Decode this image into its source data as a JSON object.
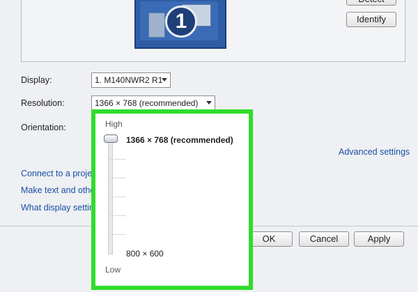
{
  "top_buttons": {
    "detect": "Detect",
    "identify": "Identify"
  },
  "monitor": {
    "number": "1"
  },
  "fields": {
    "display_label": "Display:",
    "display_value": "1. M140NWR2 R1",
    "resolution_label": "Resolution:",
    "resolution_value": "1366 × 768 (recommended)",
    "orientation_label": "Orientation:"
  },
  "links": {
    "advanced": "Advanced settings",
    "projector": "Connect to a projec",
    "text_size": "Make text and other",
    "display_settings": "What display setting"
  },
  "popup": {
    "high": "High",
    "low": "Low",
    "top_option": "1366 × 768 (recommended)",
    "bottom_option": "800 × 600"
  },
  "buttons": {
    "ok": "OK",
    "cancel": "Cancel",
    "apply": "Apply"
  },
  "colors": {
    "highlight": "#2fdc2b",
    "link": "#1a4fa5"
  }
}
